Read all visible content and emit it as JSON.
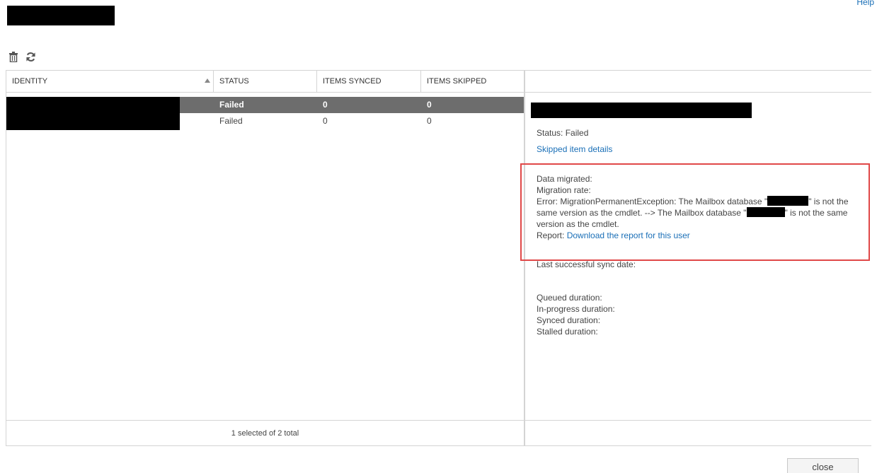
{
  "header": {
    "help_label": "Help"
  },
  "toolbar": {
    "delete_icon": "trash-icon",
    "refresh_icon": "refresh-icon"
  },
  "list": {
    "columns": [
      "IDENTITY",
      "STATUS",
      "ITEMS SYNCED",
      "ITEMS SKIPPED"
    ],
    "rows": [
      {
        "status": "Failed",
        "synced": "0",
        "skipped": "0",
        "selected": true
      },
      {
        "status": "Failed",
        "synced": "0",
        "skipped": "0",
        "selected": false
      }
    ],
    "footer": "1 selected of 2 total"
  },
  "details": {
    "status": "Status: Failed",
    "skipped_link": "Skipped item details",
    "data_migrated": "Data migrated:",
    "migration_rate": "Migration rate:",
    "error_prefix": "Error: MigrationPermanentException: The Mailbox database \"",
    "error_mid": "\" is not the same version as the cmdlet. --> The Mailbox database \"",
    "error_suffix": "\" is not the same version as the cmdlet.",
    "report_label": "Report:",
    "report_link": "Download the report for this user",
    "last_sync": "Last successful sync date:",
    "queued": "Queued duration:",
    "in_progress": "In-progress duration:",
    "synced": "Synced duration:",
    "stalled": "Stalled duration:"
  },
  "footer": {
    "close_label": "close"
  },
  "colors": {
    "selected_row": "#6d6d6d",
    "link": "#1a6fb7",
    "highlight": "#e04848"
  }
}
